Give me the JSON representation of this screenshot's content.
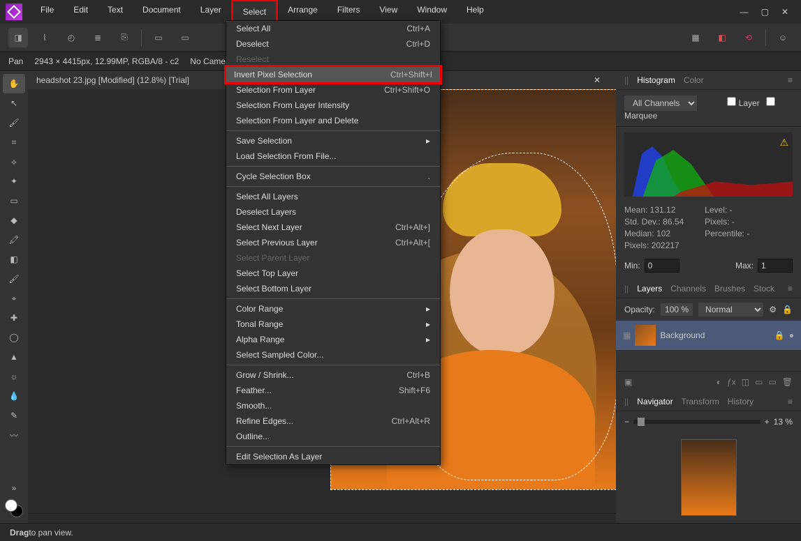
{
  "menubar": {
    "items": [
      "File",
      "Edit",
      "Text",
      "Document",
      "Layer",
      "Select",
      "Arrange",
      "Filters",
      "View",
      "Window",
      "Help"
    ],
    "highlighted_index": 5
  },
  "window_controls": {
    "min": "—",
    "max": "▢",
    "close": "✕"
  },
  "contextbar": {
    "tool": "Pan",
    "doc_info": "2943 × 4415px, 12.99MP, RGBA/8 - c2",
    "camera": "No Camera Data"
  },
  "tab": {
    "title": "headshot 23.jpg [Modified] (12.8%) [Trial]"
  },
  "dropdown": {
    "groups": [
      [
        {
          "label": "Select All",
          "shortcut": "Ctrl+A"
        },
        {
          "label": "Deselect",
          "shortcut": "Ctrl+D"
        },
        {
          "label": "Reselect",
          "disabled": true
        },
        {
          "label": "Invert Pixel Selection",
          "shortcut": "Ctrl+Shift+I",
          "highlighted": true
        },
        {
          "label": "Selection From Layer",
          "shortcut": "Ctrl+Shift+O"
        },
        {
          "label": "Selection From Layer Intensity"
        },
        {
          "label": "Selection From Layer and Delete"
        }
      ],
      [
        {
          "label": "Save Selection",
          "submenu": true
        },
        {
          "label": "Load Selection From File..."
        }
      ],
      [
        {
          "label": "Cycle Selection Box",
          "shortcut": "."
        }
      ],
      [
        {
          "label": "Select All Layers"
        },
        {
          "label": "Deselect Layers"
        },
        {
          "label": "Select Next Layer",
          "shortcut": "Ctrl+Alt+]"
        },
        {
          "label": "Select Previous Layer",
          "shortcut": "Ctrl+Alt+["
        },
        {
          "label": "Select Parent Layer",
          "disabled": true
        },
        {
          "label": "Select Top Layer"
        },
        {
          "label": "Select Bottom Layer"
        }
      ],
      [
        {
          "label": "Color Range",
          "submenu": true
        },
        {
          "label": "Tonal Range",
          "submenu": true
        },
        {
          "label": "Alpha Range",
          "submenu": true
        },
        {
          "label": "Select Sampled Color..."
        }
      ],
      [
        {
          "label": "Grow / Shrink...",
          "shortcut": "Ctrl+B"
        },
        {
          "label": "Feather...",
          "shortcut": "Shift+F6"
        },
        {
          "label": "Smooth..."
        },
        {
          "label": "Refine Edges...",
          "shortcut": "Ctrl+Alt+R"
        },
        {
          "label": "Outline..."
        }
      ],
      [
        {
          "label": "Edit Selection As Layer"
        }
      ]
    ]
  },
  "histogram_panel": {
    "tabs": [
      "Histogram",
      "Color"
    ],
    "active_tab": 0,
    "channel": "All Channels",
    "layer_label": "Layer",
    "marquee_label": "Marquee",
    "stats_left": [
      "Mean: 131.12",
      "Std. Dev.: 86.54",
      "Median: 102",
      "Pixels: 202217"
    ],
    "stats_right": [
      "Level: -",
      "Pixels: -",
      "Percentile: -"
    ],
    "min_label": "Min:",
    "min_value": "0",
    "max_label": "Max:",
    "max_value": "1"
  },
  "layers_panel": {
    "tabs": [
      "Layers",
      "Channels",
      "Brushes",
      "Stock"
    ],
    "active_tab": 0,
    "opacity_label": "Opacity:",
    "opacity_value": "100 %",
    "blend_mode": "Normal",
    "layer_name": "Background"
  },
  "navigator_panel": {
    "tabs": [
      "Navigator",
      "Transform",
      "History"
    ],
    "active_tab": 0,
    "zoom_value": "13 %"
  },
  "statusbar": {
    "hint_prefix": "Drag",
    "hint_rest": " to pan view."
  },
  "left_tools": [
    "hand",
    "pointer",
    "brush",
    "crop",
    "flood",
    "wand",
    "marquee",
    "shape",
    "paint",
    "eraser",
    "color",
    "clone",
    "healing",
    "sponge",
    "inpaint",
    "dodge",
    "blur",
    "pen",
    "smudge"
  ],
  "nav_buttons": {
    "minus": "−",
    "plus": "+"
  }
}
